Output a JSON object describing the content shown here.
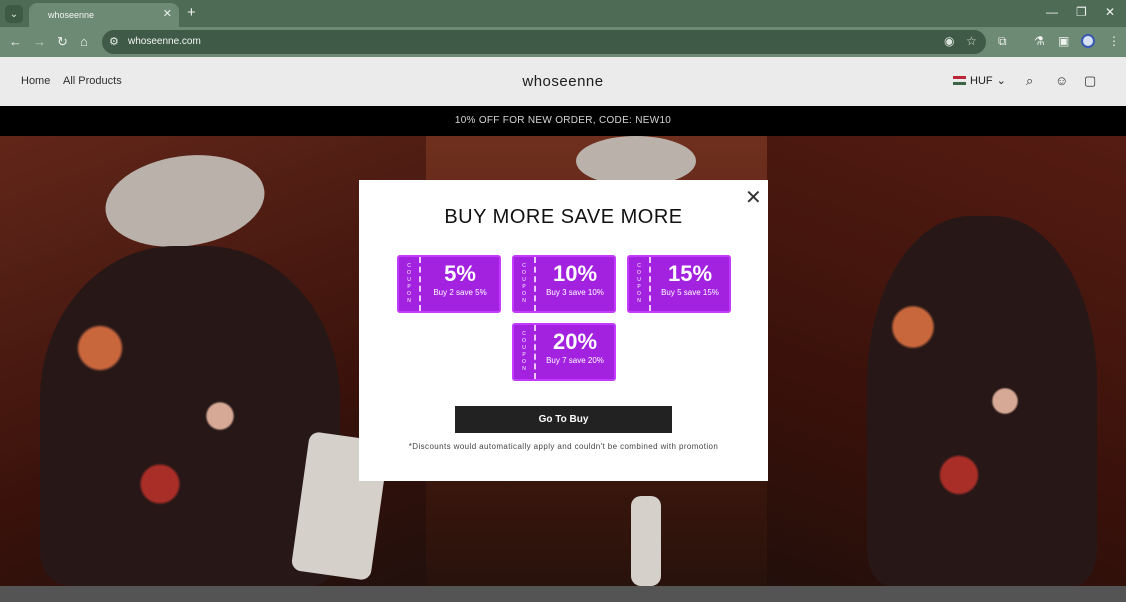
{
  "browser": {
    "tab_title": "whoseenne",
    "url": "whoseenne.com",
    "icons": [
      "tab-list-icon",
      "close-tab-icon",
      "new-tab-icon",
      "minimize-icon",
      "restore-icon",
      "close-window-icon",
      "back-icon",
      "forward-icon",
      "reload-icon",
      "home-icon",
      "site-info-icon",
      "eye-slash-icon",
      "bookmark-star-icon",
      "extensions-icon",
      "labs-icon",
      "side-panel-icon",
      "profile-icon",
      "menu-icon"
    ]
  },
  "site": {
    "nav": [
      "Home",
      "All Products"
    ],
    "brand": "whoseenne",
    "currency": "HUF",
    "announcement": "10% OFF FOR NEW ORDER, CODE: NEW10",
    "header_icons": [
      "search-icon",
      "account-icon",
      "cart-icon"
    ]
  },
  "modal": {
    "title": "BUY MORE SAVE MORE",
    "coupon_side_label": "COUPON",
    "coupons": [
      {
        "pct": "5%",
        "desc": "Buy 2 save 5%"
      },
      {
        "pct": "10%",
        "desc": "Buy 3 save 10%"
      },
      {
        "pct": "15%",
        "desc": "Buy 5 save 15%"
      },
      {
        "pct": "20%",
        "desc": "Buy 7 save 20%"
      }
    ],
    "button": "Go To Buy",
    "disclaimer": "*Discounts would automatically apply and couldn't be combined with promotion"
  },
  "colors": {
    "coupon": "#a322e0",
    "chrome": "#6d8a74",
    "button": "#222222"
  }
}
